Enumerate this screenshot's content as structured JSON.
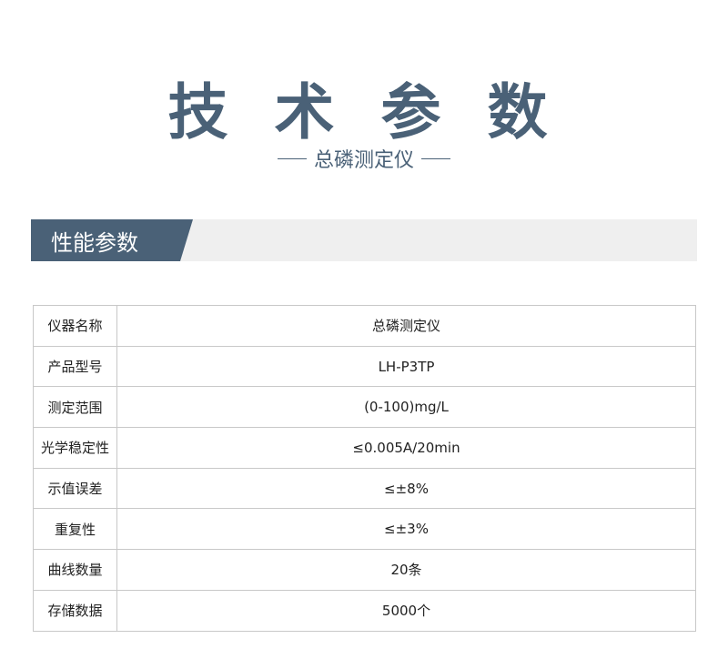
{
  "header": {
    "title": "技 术 参 数",
    "subtitle": "总磷测定仪"
  },
  "section": {
    "title": "性能参数"
  },
  "specs": [
    {
      "label": "仪器名称",
      "value": "总磷测定仪"
    },
    {
      "label": "产品型号",
      "value": "LH-P3TP"
    },
    {
      "label": "测定范围",
      "value": "(0-100)mg/L"
    },
    {
      "label": "光学稳定性",
      "value": "≤0.005A/20min"
    },
    {
      "label": "示值误差",
      "value": "≤±8%"
    },
    {
      "label": "重复性",
      "value": "≤±3%"
    },
    {
      "label": "曲线数量",
      "value": "20条"
    },
    {
      "label": "存储数据",
      "value": "5000个"
    }
  ],
  "colors": {
    "accent": "#4a6177",
    "section_bar_bg": "#efefef",
    "table_border": "#c8c8c8"
  }
}
